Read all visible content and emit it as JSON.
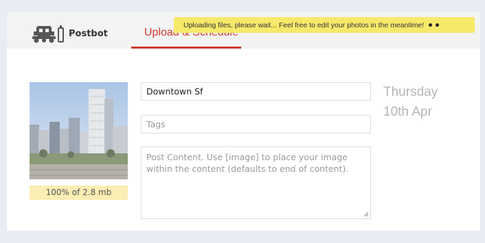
{
  "header": {
    "brand": "Postbot",
    "tab_label": "Upload & Schedule"
  },
  "toast": {
    "message": "Uploading files, please wait... Feel free to edit your photos in the meantime!"
  },
  "upload": {
    "progress_text": "100% of 2.8 mb"
  },
  "post": {
    "title_value": "Downtown Sf",
    "tags_placeholder": "Tags",
    "content_placeholder": "Post Content. Use [image] to place your image within the content (defaults to end of content)."
  },
  "schedule": {
    "day": "Thursday",
    "date": "10th Apr"
  },
  "colors": {
    "accent": "#d0392e",
    "toast_bg": "#f6e96a",
    "progress_bg": "#fbeeb3"
  }
}
